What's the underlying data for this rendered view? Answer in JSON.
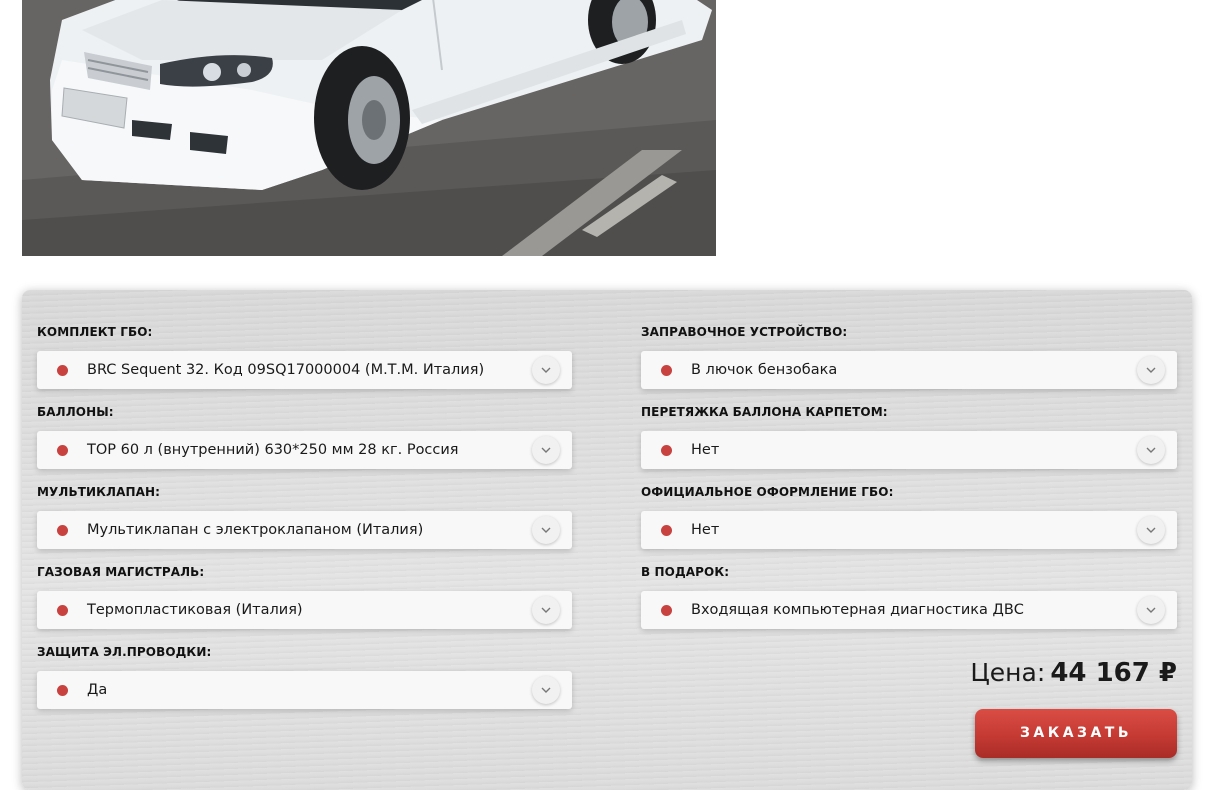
{
  "form": {
    "left": [
      {
        "label": "КОМПЛЕКТ ГБО:",
        "value": "BRC Sequent 32. Код 09SQ17000004 (М.Т.М. Италия)"
      },
      {
        "label": "БАЛЛОНЫ:",
        "value": "TOP 60 л (внутренний) 630*250 мм 28 кг. Россия"
      },
      {
        "label": "МУЛЬТИКЛАПАН:",
        "value": "Мультиклапан с электроклапаном (Италия)"
      },
      {
        "label": "ГАЗОВАЯ МАГИСТРАЛЬ:",
        "value": "Термопластиковая (Италия)"
      },
      {
        "label": "ЗАЩИТА ЭЛ.ПРОВОДКИ:",
        "value": "Да"
      }
    ],
    "right": [
      {
        "label": "ЗАПРАВОЧНОЕ УСТРОЙСТВО:",
        "value": "В лючок бензобака"
      },
      {
        "label": "ПЕРЕТЯЖКА БАЛЛОНА КАРПЕТОМ:",
        "value": "Нет"
      },
      {
        "label": "ОФИЦИАЛЬНОЕ ОФОРМЛЕНИЕ ГБО:",
        "value": "Нет"
      },
      {
        "label": "В ПОДАРОК:",
        "value": "Входящая компьютерная диагностика ДВС"
      }
    ]
  },
  "price": {
    "label": "Цена:",
    "value": "44 167 ₽"
  },
  "order_button": {
    "label": "ЗАКАЗАТЬ"
  },
  "colors": {
    "accent": "#c8423f",
    "button": "#c53a33"
  },
  "icons": {
    "bullet": "red-dot-icon",
    "dropdown": "chevron-down-icon"
  }
}
